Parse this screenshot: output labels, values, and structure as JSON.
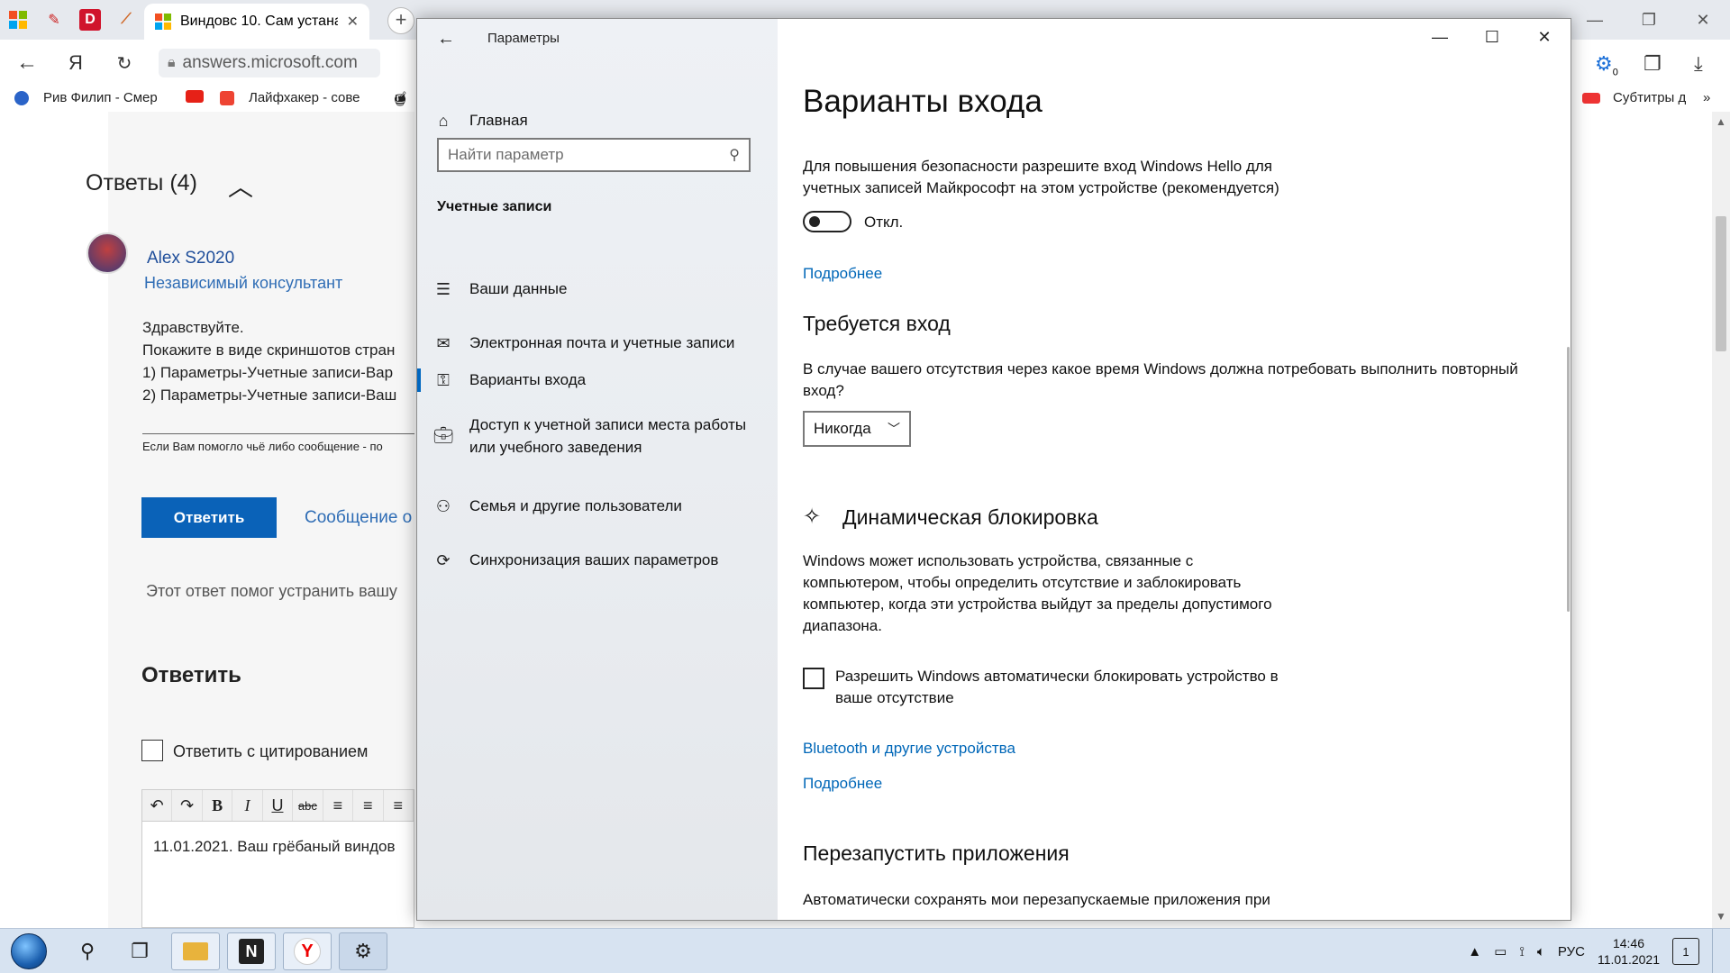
{
  "browser": {
    "active_tab_title": "Виндовс 10. Сам устана",
    "url_text": "answers.microsoft.com",
    "profile_letter": "Я",
    "bookmarks": [
      {
        "label": "Рив Филип - Смер"
      },
      {
        "label": "Лайфхакер - сове"
      },
      {
        "label": "Субтитры д"
      }
    ],
    "badge_count": "0"
  },
  "webpage": {
    "answers_heading": "Ответы (4)",
    "author_name": "Alex S2020",
    "author_role": "Независимый консультант",
    "post_lines": [
      "Здравствуйте.",
      "Покажите в виде скриншотов стран",
      "1) Параметры-Учетные записи-Вар",
      "2) Параметры-Учетные записи-Ваш"
    ],
    "signature": "Если Вам помогло чьё либо сообщение - по",
    "reply_button": "Ответить",
    "report_link": "Сообщение о",
    "helpful_text": "Этот ответ помог устранить вашу",
    "reply_heading": "Ответить",
    "quote_label": "Ответить с цитированием",
    "editor_text": "11.01.2021.  Ваш грёбаный виндов"
  },
  "settings": {
    "window_title": "Параметры",
    "nav_home": "Главная",
    "search_placeholder": "Найти параметр",
    "section_title": "Учетные записи",
    "nav_items": [
      {
        "label": "Ваши данные",
        "icon": "user-info-icon"
      },
      {
        "label": "Электронная почта и учетные записи",
        "icon": "mail-icon"
      },
      {
        "label": "Варианты входа",
        "icon": "key-icon",
        "selected": true
      },
      {
        "label": "Доступ к учетной записи места работы",
        "label2": "или учебного заведения",
        "icon": "briefcase-icon"
      },
      {
        "label": "Семья и другие пользователи",
        "icon": "add-user-icon"
      },
      {
        "label": "Синхронизация ваших параметров",
        "icon": "sync-icon"
      }
    ],
    "content": {
      "title": "Варианты входа",
      "hello_text_1": "Для повышения безопасности разрешите вход Windows Hello для",
      "hello_text_2": "учетных записей Майкрософт на этом устройстве (рекомендуется)",
      "hello_toggle_state": "Откл.",
      "more_link_1": "Подробнее",
      "require_signin_heading": "Требуется вход",
      "require_text_1": "В случае вашего отсутствия через какое время Windows должна потребовать выполнить повторный",
      "require_text_2": "вход?",
      "require_select_value": "Никогда",
      "dynamic_lock_heading": "Динамическая блокировка",
      "dynamic_text_1": "Windows может использовать устройства, связанные с",
      "dynamic_text_2": "компьютером, чтобы определить отсутствие и заблокировать",
      "dynamic_text_3": "компьютер, когда эти устройства выйдут за пределы допустимого",
      "dynamic_text_4": "диапазона.",
      "dynamic_check_1": "Разрешить Windows автоматически блокировать устройство в",
      "dynamic_check_2": "ваше отсутствие",
      "bluetooth_link": "Bluetooth и другие устройства",
      "more_link_2": "Подробнее",
      "restart_heading": "Перезапустить приложения",
      "restart_text_1": "Автоматически сохранять мои перезапускаемые приложения при"
    }
  },
  "taskbar": {
    "language": "РУС",
    "time": "14:46",
    "date": "11.01.2021",
    "notification_count": "1"
  },
  "colors": {
    "accent": "#0067c0",
    "link": "#0067b8",
    "web_button": "#0a62b8",
    "taskbar": "#d7e3f1"
  }
}
